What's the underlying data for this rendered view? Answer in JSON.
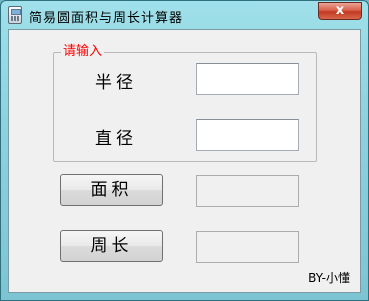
{
  "window": {
    "title": "简易圆面积与周长计算器",
    "close_symbol": "x"
  },
  "input_group": {
    "legend": "请输入",
    "radius_label": "半径",
    "radius_value": "",
    "diameter_label": "直径",
    "diameter_value": ""
  },
  "area": {
    "button_label": "面积",
    "result_value": ""
  },
  "perimeter": {
    "button_label": "周长",
    "result_value": ""
  },
  "credit": "BY-小懂",
  "icons": [
    "app-icon",
    "close-icon"
  ]
}
